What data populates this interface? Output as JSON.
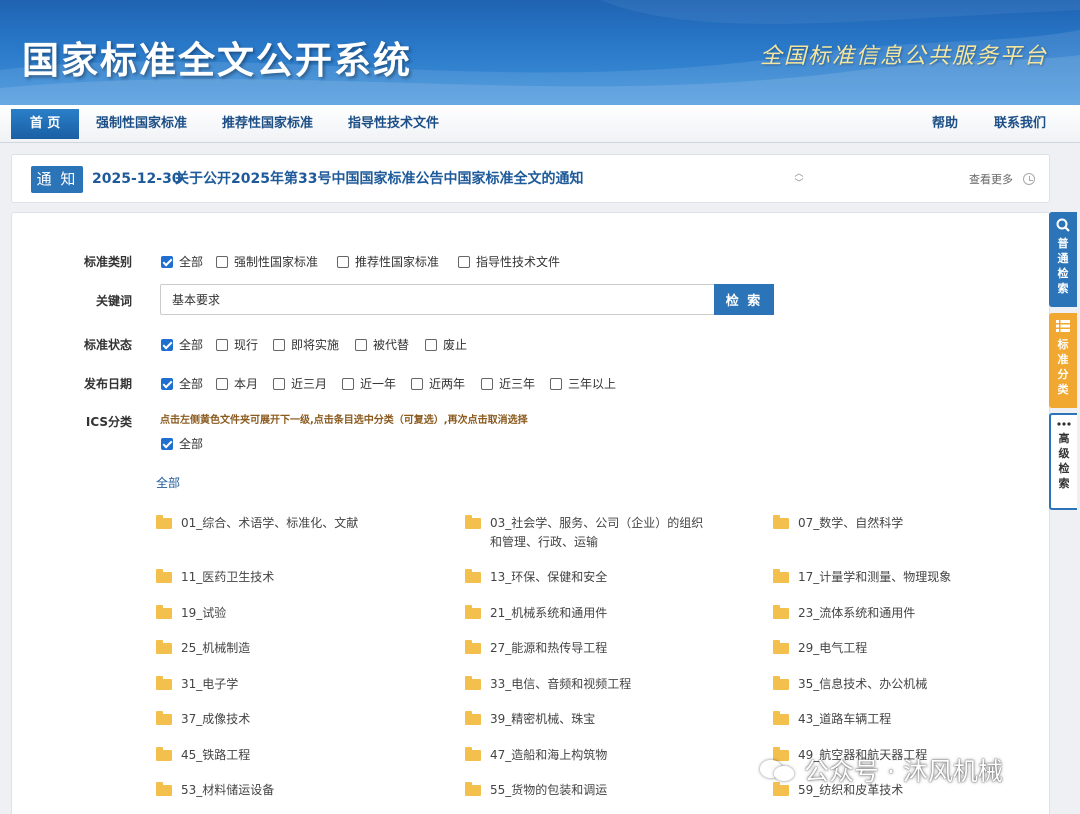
{
  "banner": {
    "title": "国家标准全文公开系统",
    "subtitle": "全国标准信息公共服务平台"
  },
  "nav": {
    "items": [
      {
        "label": "首 页",
        "active": true
      },
      {
        "label": "强制性国家标准"
      },
      {
        "label": "推荐性国家标准"
      },
      {
        "label": "指导性技术文件"
      }
    ],
    "right": [
      {
        "label": "帮助"
      },
      {
        "label": "联系我们"
      }
    ]
  },
  "notice": {
    "tag": "通 知",
    "date": "2025-12-30",
    "text": "关于公开2025年第33号中国国家标准公告中国家标准全文的通知",
    "more": "查看更多"
  },
  "form": {
    "category": {
      "label": "标准类别",
      "options": [
        {
          "label": "全部",
          "checked": true
        },
        {
          "label": "强制性国家标准",
          "checked": false
        },
        {
          "label": "推荐性国家标准",
          "checked": false
        },
        {
          "label": "指导性技术文件",
          "checked": false
        }
      ]
    },
    "keyword": {
      "label": "关键词",
      "value": "基本要求",
      "button": "检 索"
    },
    "status": {
      "label": "标准状态",
      "options": [
        {
          "label": "全部",
          "checked": true
        },
        {
          "label": "现行",
          "checked": false
        },
        {
          "label": "即将实施",
          "checked": false
        },
        {
          "label": "被代替",
          "checked": false
        },
        {
          "label": "废止",
          "checked": false
        }
      ]
    },
    "date": {
      "label": "发布日期",
      "options": [
        {
          "label": "全部",
          "checked": true
        },
        {
          "label": "本月",
          "checked": false
        },
        {
          "label": "近三月",
          "checked": false
        },
        {
          "label": "近一年",
          "checked": false
        },
        {
          "label": "近两年",
          "checked": false
        },
        {
          "label": "近三年",
          "checked": false
        },
        {
          "label": "三年以上",
          "checked": false
        }
      ]
    },
    "ics": {
      "label": "ICS分类",
      "hint": "点击左侧黄色文件夹可展开下一级,点击条目选中分类（可复选）,再次点击取消选择",
      "all_option": {
        "label": "全部",
        "checked": true
      },
      "root": "全部",
      "items": [
        "01_综合、术语学、标准化、文献",
        "03_社会学、服务、公司（企业）的组织和管理、行政、运输",
        "07_数学、自然科学",
        "11_医药卫生技术",
        "13_环保、保健和安全",
        "17_计量学和测量、物理现象",
        "19_试验",
        "21_机械系统和通用件",
        "23_流体系统和通用件",
        "25_机械制造",
        "27_能源和热传导工程",
        "29_电气工程",
        "31_电子学",
        "33_电信、音频和视频工程",
        "35_信息技术、办公机械",
        "37_成像技术",
        "39_精密机械、珠宝",
        "43_道路车辆工程",
        "45_铁路工程",
        "47_造船和海上构筑物",
        "49_航空器和航天器工程",
        "53_材料储运设备",
        "55_货物的包装和调运",
        "59_纺织和皮革技术"
      ]
    }
  },
  "side_tabs": [
    {
      "label": "普通检索",
      "color": "#2b74b8",
      "icon": "search-icon"
    },
    {
      "label": "标准分类",
      "color": "#f0a830",
      "icon": "list-icon"
    },
    {
      "label": "高级检索",
      "color": "#ffffff",
      "icon": "more-icon"
    }
  ],
  "watermark": "公众号 · 沐风机械"
}
